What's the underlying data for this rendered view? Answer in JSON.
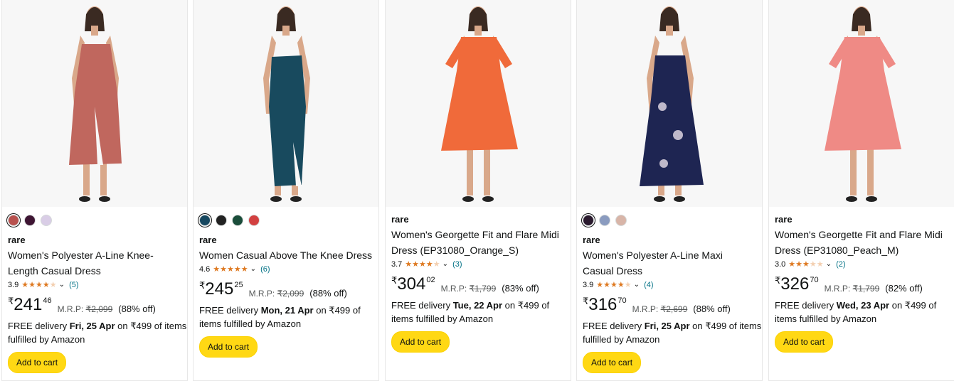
{
  "products": [
    {
      "swatches": [
        "#b8514e",
        "#3e1533",
        "#d9cde6"
      ],
      "brand": "rare",
      "title": "Women's Polyester A-Line Knee-Length Casual Dress",
      "rating": "3.9",
      "stars": 3.9,
      "reviews": "(5)",
      "currency": "₹",
      "price_whole": "241",
      "price_fraction": "46",
      "mrp_label": "M.R.P:",
      "mrp_value": "₹2,099",
      "discount": "(88% off)",
      "delivery_prefix": "FREE delivery ",
      "delivery_date": "Fri, 25 Apr",
      "delivery_suffix": " on ₹499 of items fulfilled by Amazon",
      "button": "Add to cart",
      "dress_color": "#c0675e"
    },
    {
      "swatches": [
        "#174860",
        "#222222",
        "#1a4d3a",
        "#d24040"
      ],
      "brand": "rare",
      "title": "Women Casual Above The Knee Dress",
      "rating": "4.6",
      "stars": 4.6,
      "reviews": "(6)",
      "currency": "₹",
      "price_whole": "245",
      "price_fraction": "25",
      "mrp_label": "M.R.P:",
      "mrp_value": "₹2,099",
      "discount": "(88% off)",
      "delivery_prefix": "FREE delivery ",
      "delivery_date": "Mon, 21 Apr",
      "delivery_suffix": " on ₹499 of items fulfilled by Amazon",
      "button": "Add to cart",
      "dress_color": "#184a5e"
    },
    {
      "swatches": [],
      "brand": "rare",
      "title": "Women's Georgette Fit and Flare Midi Dress (EP31080_Orange_S)",
      "rating": "3.7",
      "stars": 3.7,
      "reviews": "(3)",
      "currency": "₹",
      "price_whole": "304",
      "price_fraction": "02",
      "mrp_label": "M.R.P:",
      "mrp_value": "₹1,799",
      "discount": "(83% off)",
      "delivery_prefix": "FREE delivery ",
      "delivery_date": "Tue, 22 Apr",
      "delivery_suffix": " on ₹499 of items fulfilled by Amazon",
      "button": "Add to cart",
      "dress_color": "#f06a3a"
    },
    {
      "swatches": [
        "#2a1a2e",
        "#8a9bbf",
        "#d8b5a8"
      ],
      "brand": "rare",
      "title": "Women's Polyester A-Line Maxi Casual Dress",
      "rating": "3.9",
      "stars": 3.9,
      "reviews": "(4)",
      "currency": "₹",
      "price_whole": "316",
      "price_fraction": "70",
      "mrp_label": "M.R.P:",
      "mrp_value": "₹2,699",
      "discount": "(88% off)",
      "delivery_prefix": "FREE delivery ",
      "delivery_date": "Fri, 25 Apr",
      "delivery_suffix": " on ₹499 of items fulfilled by Amazon",
      "button": "Add to cart",
      "dress_color": "#1e2552"
    },
    {
      "swatches": [],
      "brand": "rare",
      "title": "Women's Georgette Fit and Flare Midi Dress (EP31080_Peach_M)",
      "rating": "3.0",
      "stars": 3.0,
      "reviews": "(2)",
      "currency": "₹",
      "price_whole": "326",
      "price_fraction": "70",
      "mrp_label": "M.R.P:",
      "mrp_value": "₹1,799",
      "discount": "(82% off)",
      "delivery_prefix": "FREE delivery ",
      "delivery_date": "Wed, 23 Apr",
      "delivery_suffix": " on ₹499 of items fulfilled by Amazon",
      "button": "Add to cart",
      "dress_color": "#ef8a85"
    }
  ]
}
